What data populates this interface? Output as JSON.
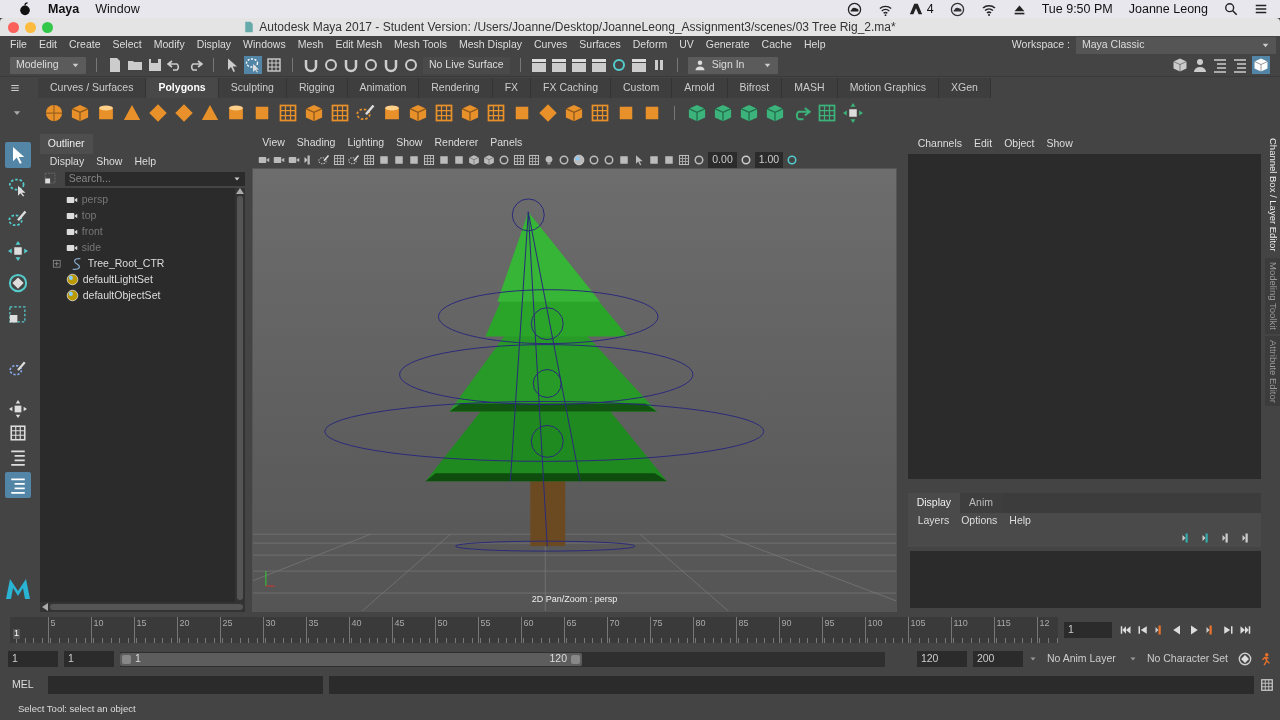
{
  "mac_menubar": {
    "app": "Maya",
    "menus": [
      "Window"
    ],
    "adobe_count": "4",
    "clock": "Tue 9:50 PM",
    "user": "Joanne Leong"
  },
  "window": {
    "title": "Autodesk Maya 2017 - Student Version: /Users/Joanne/Desktop/JoanneLeong_Assignment3/scenes/03 Tree Rig_2.ma*"
  },
  "menu_bar": [
    "File",
    "Edit",
    "Create",
    "Select",
    "Modify",
    "Display",
    "Windows",
    "Mesh",
    "Edit Mesh",
    "Mesh Tools",
    "Mesh Display",
    "Curves",
    "Surfaces",
    "Deform",
    "UV",
    "Generate",
    "Cache",
    "Help"
  ],
  "workspace": {
    "label": "Workspace :",
    "value": "Maya Classic"
  },
  "status_line": {
    "menu_set": "Modeling",
    "live_surface": "No Live Surface",
    "sign_in": "Sign In"
  },
  "shelf_tabs": [
    {
      "label": "Curves / Surfaces",
      "selected": false
    },
    {
      "label": "Polygons",
      "selected": true
    },
    {
      "label": "Sculpting",
      "selected": false
    },
    {
      "label": "Rigging",
      "selected": false
    },
    {
      "label": "Animation",
      "selected": false
    },
    {
      "label": "Rendering",
      "selected": false
    },
    {
      "label": "FX",
      "selected": false
    },
    {
      "label": "FX Caching",
      "selected": false
    },
    {
      "label": "Custom",
      "selected": false
    },
    {
      "label": "Arnold",
      "selected": false
    },
    {
      "label": "Bifrost",
      "selected": false
    },
    {
      "label": "MASH",
      "selected": false
    },
    {
      "label": "Motion Graphics",
      "selected": false
    },
    {
      "label": "XGen",
      "selected": false
    }
  ],
  "outliner": {
    "title": "Outliner",
    "menus": [
      "Display",
      "Show",
      "Help"
    ],
    "placeholder": "Search...",
    "items": [
      {
        "label": "persp",
        "kind": "camera",
        "dimmed": true
      },
      {
        "label": "top",
        "kind": "camera",
        "dimmed": true
      },
      {
        "label": "front",
        "kind": "camera",
        "dimmed": true
      },
      {
        "label": "side",
        "kind": "camera",
        "dimmed": true
      },
      {
        "label": "Tree_Root_CTR",
        "kind": "curve",
        "dimmed": false,
        "expandable": true
      },
      {
        "label": "defaultLightSet",
        "kind": "set",
        "dimmed": false
      },
      {
        "label": "defaultObjectSet",
        "kind": "set",
        "dimmed": false
      }
    ]
  },
  "viewport": {
    "menus": [
      "View",
      "Shading",
      "Lighting",
      "Show",
      "Renderer",
      "Panels"
    ],
    "exposure": "0.00",
    "gamma": "1.00",
    "hud": "2D Pan/Zoom : persp"
  },
  "channel_box": {
    "menus": [
      "Channels",
      "Edit",
      "Object",
      "Show"
    ]
  },
  "layer_editor": {
    "tabs": [
      {
        "label": "Display",
        "selected": true
      },
      {
        "label": "Anim",
        "selected": false
      }
    ],
    "menus": [
      "Layers",
      "Options",
      "Help"
    ]
  },
  "side_tabs": [
    {
      "label": "Channel Box / Layer Editor",
      "selected": true
    },
    {
      "label": "Modeling Toolkit",
      "selected": false
    },
    {
      "label": "Attribute Editor",
      "selected": false
    }
  ],
  "timeline": {
    "current_frame": "1",
    "ticks": [
      "5",
      "10",
      "15",
      "20",
      "25",
      "30",
      "35",
      "40",
      "45",
      "50",
      "55",
      "60",
      "65",
      "70",
      "75",
      "80",
      "85",
      "90",
      "95",
      "100",
      "105",
      "110",
      "115",
      "12"
    ],
    "current_time_field": "1"
  },
  "range": {
    "start": "1",
    "playback_start": "1",
    "slider_start": "1",
    "slider_end": "120",
    "playback_end": "120",
    "end": "200",
    "anim_layer": "No Anim Layer",
    "character_set": "No Character Set"
  },
  "command_line": {
    "label": "MEL"
  },
  "help_line": "Select Tool: select an object"
}
